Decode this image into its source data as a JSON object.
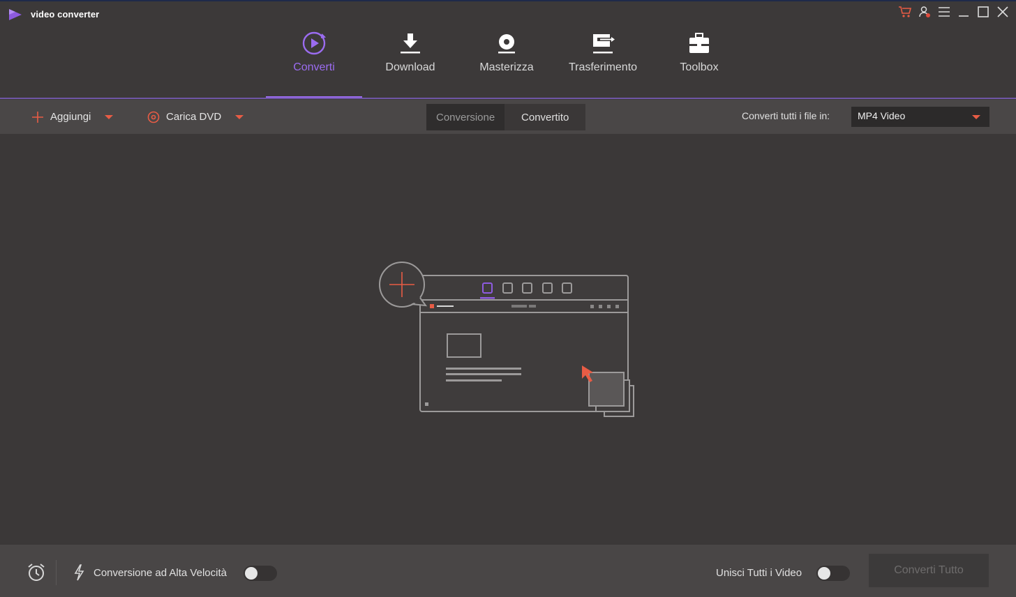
{
  "app": {
    "title": "video converter",
    "accent_color": "#9b6cf0",
    "action_color": "#e85c45"
  },
  "window_controls": [
    "cart-icon",
    "user-icon",
    "menu-icon",
    "minimize-icon",
    "maximize-icon",
    "close-icon"
  ],
  "nav": {
    "items": [
      {
        "label": "Converti",
        "icon": "convert-icon",
        "active": true
      },
      {
        "label": "Download",
        "icon": "download-icon",
        "active": false
      },
      {
        "label": "Masterizza",
        "icon": "burn-disc-icon",
        "active": false
      },
      {
        "label": "Trasferimento",
        "icon": "transfer-icon",
        "active": false
      },
      {
        "label": "Toolbox",
        "icon": "toolbox-icon",
        "active": false
      }
    ]
  },
  "toolbar": {
    "add_label": "Aggiungi",
    "load_dvd_label": "Carica DVD",
    "tabs": [
      {
        "label": "Conversione",
        "selected": true
      },
      {
        "label": "Convertito",
        "selected": false
      }
    ],
    "convert_all_to_label": "Converti tutti i file in:",
    "output_format": "MP4 Video"
  },
  "footer": {
    "high_speed_label": "Conversione ad Alta Velocità",
    "high_speed_on": false,
    "merge_label": "Unisci Tutti i Video",
    "merge_on": false,
    "convert_all_button": "Converti Tutto"
  }
}
